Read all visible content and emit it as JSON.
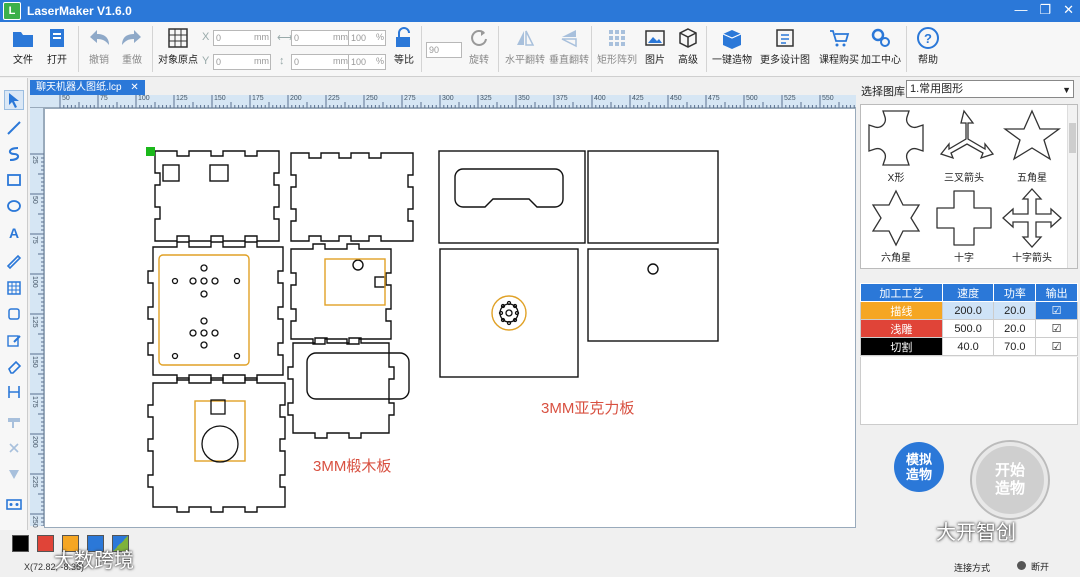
{
  "app": {
    "title": "LaserMaker V1.6.0",
    "logo_letter": "L"
  },
  "window_controls": [
    "—",
    "❐",
    "✕"
  ],
  "toolbar": {
    "file": "文件",
    "open": "打开",
    "undo": "撤销",
    "redo": "重做",
    "origin": "对象原点",
    "x_label": "X",
    "y_label": "Y",
    "x_value": "0",
    "y_value": "0",
    "unit_mm": "mm",
    "w_value": "0",
    "h_value": "0",
    "w_pct": "100",
    "h_pct": "100",
    "pct": "%",
    "lock_ratio": "等比",
    "rotate_angle": "90",
    "rotate": "旋转",
    "flip_h": "水平翻转",
    "flip_v": "垂直翻转",
    "array": "矩形阵列",
    "image": "图片",
    "advanced": "高级",
    "one_click": "一键造物",
    "more_designs": "更多设计图",
    "course": "课程购买",
    "center": "加工中心",
    "help": "帮助"
  },
  "document": {
    "tab_label": "聊天机器人图纸.lcp",
    "tab_close": "✕"
  },
  "ruler": {
    "h_ticks": [
      "50",
      "75",
      "100",
      "125",
      "150",
      "175",
      "200",
      "225",
      "250",
      "275",
      "300",
      "325",
      "350",
      "375",
      "400",
      "425",
      "450",
      "475",
      "500",
      "525",
      "550"
    ],
    "v_ticks": [
      "25",
      "50",
      "75",
      "100",
      "125",
      "150",
      "175",
      "200",
      "225",
      "250",
      "275"
    ]
  },
  "canvas": {
    "label_wood": "3MM椴木板",
    "label_acrylic": "3MM亚克力板"
  },
  "library": {
    "label": "选择图库:",
    "selected": "1.常用图形",
    "shapes": [
      "X形",
      "三叉箭头",
      "五角星",
      "六角星",
      "十字",
      "十字箭头"
    ]
  },
  "process_table": {
    "headers": [
      "加工工艺",
      "速度",
      "功率",
      "输出"
    ],
    "rows": [
      {
        "name": "描线",
        "speed": "200.0",
        "power": "20.0",
        "checked": "☑",
        "color": "#f5a623"
      },
      {
        "name": "浅雕",
        "speed": "500.0",
        "power": "20.0",
        "checked": "☑",
        "color": "#e04438"
      },
      {
        "name": "切割",
        "speed": "40.0",
        "power": "70.0",
        "checked": "☑",
        "color": "#000000"
      }
    ]
  },
  "actions": {
    "simulate": "模拟造物",
    "start": "开始造物"
  },
  "status": {
    "coords": "X(72.82, -8.36)",
    "connection_label": "连接方式",
    "connection_status": "断开",
    "watermark_left": "大数跨境",
    "watermark_right": "大开智创"
  },
  "swatch_colors": [
    "#000000",
    "#e04438",
    "#f5a623",
    "#2b78d8",
    "#7fb23a"
  ]
}
